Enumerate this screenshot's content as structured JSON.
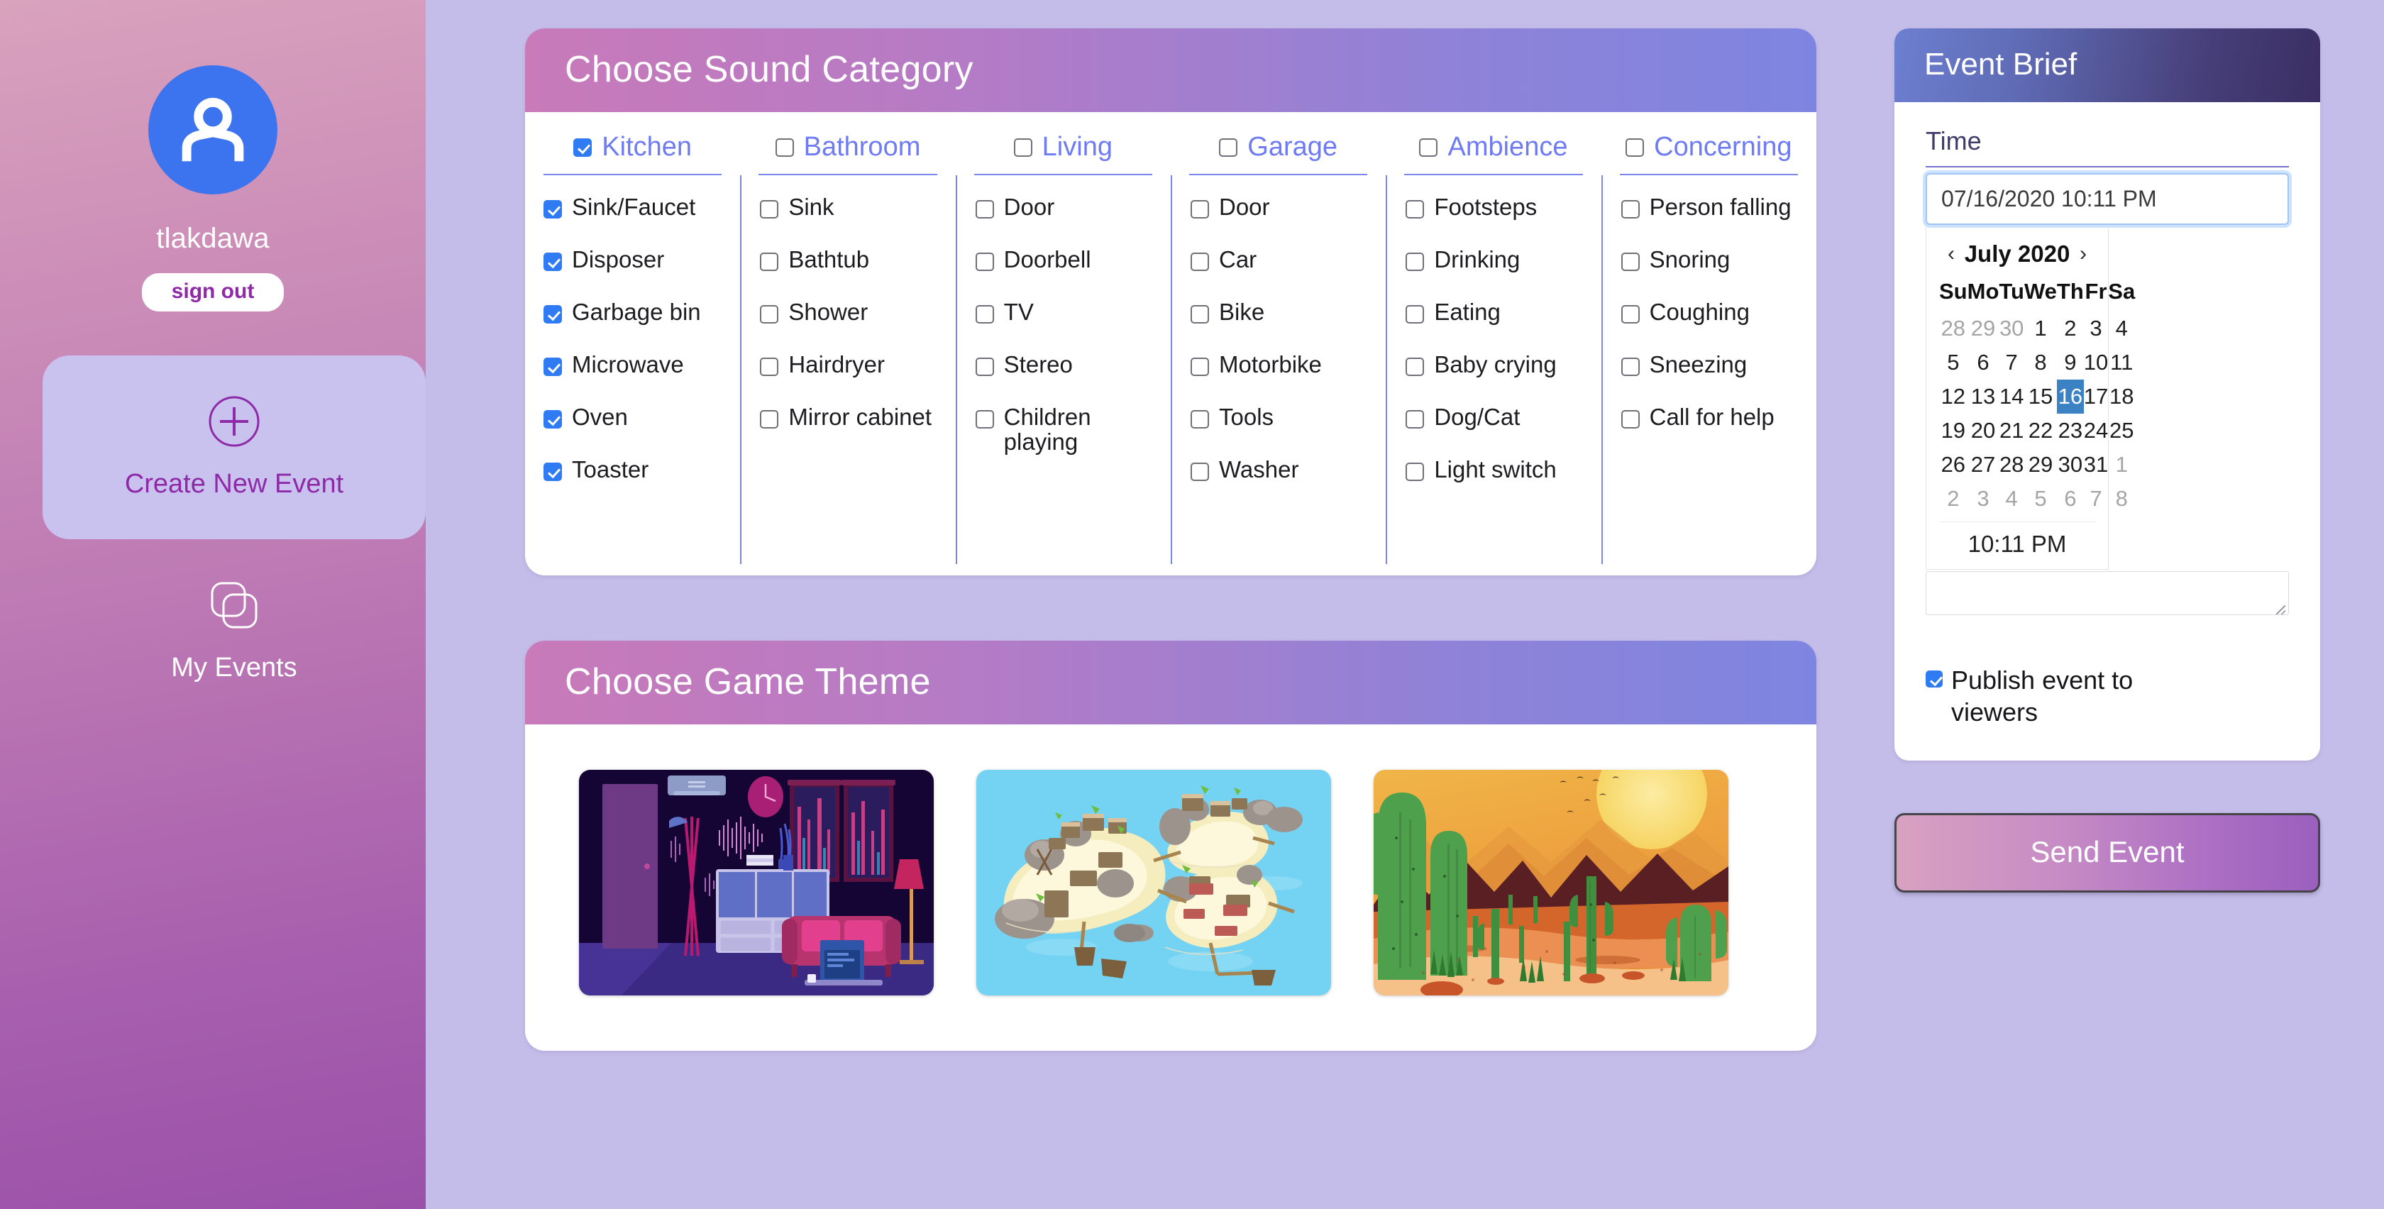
{
  "colors": {
    "background": "#c4bce9",
    "sidebar_gradient_from": "#d9a2bd",
    "sidebar_gradient_to": "#9a51a9",
    "accent_blue": "#2f7bf4",
    "category_label": "#6e7bf2",
    "header_gradient_from": "#c87ab9",
    "header_gradient_to": "#7e85e0",
    "brief_header_from": "#6d7fd0",
    "brief_header_to": "#3a2e63",
    "selected_day": "#3a82c4",
    "send_button_from": "#d9a1c1",
    "send_button_to": "#9b5fbe"
  },
  "sidebar": {
    "avatar_icon": "user-avatar-icon",
    "username": "tlakdawa",
    "sign_out_label": "sign out",
    "nav": [
      {
        "id": "create-new-event",
        "label": "Create New Event",
        "icon": "plus-circle-icon",
        "active": true
      },
      {
        "id": "my-events",
        "label": "My Events",
        "icon": "layered-squares-icon",
        "active": false
      }
    ]
  },
  "sound_card": {
    "title": "Choose Sound Category",
    "categories": [
      {
        "name": "Kitchen",
        "checked": true,
        "items": [
          {
            "label": "Sink/Faucet",
            "checked": true
          },
          {
            "label": "Disposer",
            "checked": true
          },
          {
            "label": "Garbage bin",
            "checked": true
          },
          {
            "label": "Microwave",
            "checked": true
          },
          {
            "label": "Oven",
            "checked": true
          },
          {
            "label": "Toaster",
            "checked": true
          }
        ]
      },
      {
        "name": "Bathroom",
        "checked": false,
        "items": [
          {
            "label": "Sink",
            "checked": false
          },
          {
            "label": "Bathtub",
            "checked": false
          },
          {
            "label": "Shower",
            "checked": false
          },
          {
            "label": "Hairdryer",
            "checked": false
          },
          {
            "label": "Mirror cabinet",
            "checked": false
          }
        ]
      },
      {
        "name": "Living",
        "checked": false,
        "items": [
          {
            "label": "Door",
            "checked": false
          },
          {
            "label": "Doorbell",
            "checked": false
          },
          {
            "label": "TV",
            "checked": false
          },
          {
            "label": "Stereo",
            "checked": false
          },
          {
            "label": "Children playing",
            "checked": false
          }
        ]
      },
      {
        "name": "Garage",
        "checked": false,
        "items": [
          {
            "label": "Door",
            "checked": false
          },
          {
            "label": "Car",
            "checked": false
          },
          {
            "label": "Bike",
            "checked": false
          },
          {
            "label": "Motorbike",
            "checked": false
          },
          {
            "label": "Tools",
            "checked": false
          },
          {
            "label": "Washer",
            "checked": false
          }
        ]
      },
      {
        "name": "Ambience",
        "checked": false,
        "items": [
          {
            "label": "Footsteps",
            "checked": false
          },
          {
            "label": "Drinking",
            "checked": false
          },
          {
            "label": "Eating",
            "checked": false
          },
          {
            "label": "Baby crying",
            "checked": false
          },
          {
            "label": "Dog/Cat",
            "checked": false
          },
          {
            "label": "Light switch",
            "checked": false
          }
        ]
      },
      {
        "name": "Concerning",
        "checked": false,
        "items": [
          {
            "label": "Person falling",
            "checked": false
          },
          {
            "label": "Snoring",
            "checked": false
          },
          {
            "label": "Coughing",
            "checked": false
          },
          {
            "label": "Sneezing",
            "checked": false
          },
          {
            "label": "Call for help",
            "checked": false
          }
        ]
      }
    ]
  },
  "game_card": {
    "title": "Choose Game Theme",
    "themes": [
      {
        "id": "night-living-room",
        "name": "Night living room with neon sound waves"
      },
      {
        "id": "pirate-islands",
        "name": "Pirate islands map on blue water"
      },
      {
        "id": "desert-sunset",
        "name": "Desert sunset with cacti and mountains"
      }
    ]
  },
  "event_brief": {
    "title": "Event Brief",
    "time_label": "Time",
    "time_value": "07/16/2020 10:11 PM",
    "notes_value": "",
    "calendar": {
      "prev_label": "‹",
      "next_label": "›",
      "month_title": "July 2020",
      "weekdays": [
        "Su",
        "Mo",
        "Tu",
        "We",
        "Th",
        "Fr",
        "Sa"
      ],
      "weeks": [
        [
          {
            "d": "28",
            "muted": true
          },
          {
            "d": "29",
            "muted": true
          },
          {
            "d": "30",
            "muted": true
          },
          {
            "d": "1"
          },
          {
            "d": "2"
          },
          {
            "d": "3"
          },
          {
            "d": "4"
          }
        ],
        [
          {
            "d": "5"
          },
          {
            "d": "6"
          },
          {
            "d": "7"
          },
          {
            "d": "8"
          },
          {
            "d": "9"
          },
          {
            "d": "10"
          },
          {
            "d": "11"
          }
        ],
        [
          {
            "d": "12"
          },
          {
            "d": "13"
          },
          {
            "d": "14"
          },
          {
            "d": "15"
          },
          {
            "d": "16",
            "selected": true
          },
          {
            "d": "17"
          },
          {
            "d": "18"
          }
        ],
        [
          {
            "d": "19"
          },
          {
            "d": "20"
          },
          {
            "d": "21"
          },
          {
            "d": "22"
          },
          {
            "d": "23"
          },
          {
            "d": "24"
          },
          {
            "d": "25"
          }
        ],
        [
          {
            "d": "26"
          },
          {
            "d": "27"
          },
          {
            "d": "28"
          },
          {
            "d": "29"
          },
          {
            "d": "30"
          },
          {
            "d": "31"
          },
          {
            "d": "1",
            "muted": true
          }
        ],
        [
          {
            "d": "2",
            "muted": true
          },
          {
            "d": "3",
            "muted": true
          },
          {
            "d": "4",
            "muted": true
          },
          {
            "d": "5",
            "muted": true
          },
          {
            "d": "6",
            "muted": true
          },
          {
            "d": "7",
            "muted": true
          },
          {
            "d": "8",
            "muted": true
          }
        ]
      ],
      "time_display": "10:11 PM"
    },
    "publish_label": "Publish event to viewers",
    "publish_checked": true,
    "send_label": "Send Event"
  }
}
